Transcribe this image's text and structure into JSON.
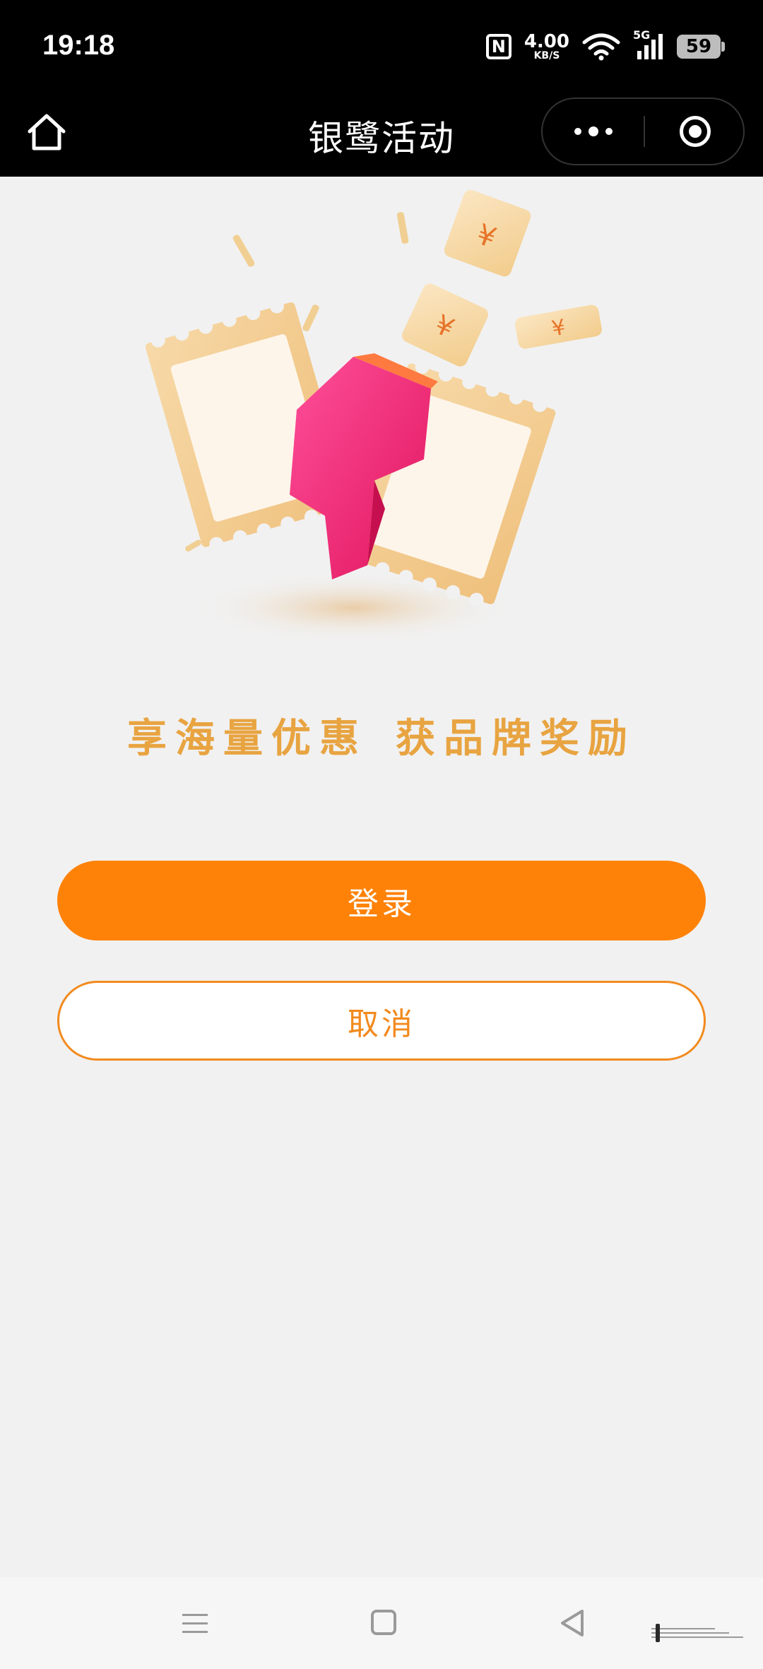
{
  "status_bar": {
    "time": "19:18",
    "nfc_label": "N",
    "net_speed": "4.00",
    "net_speed_unit": "KB/S",
    "signal_label": "5G",
    "battery": "59"
  },
  "header": {
    "title": "银鹭活动"
  },
  "main": {
    "slogan_left": "享海量优惠",
    "slogan_right": "获品牌奖励",
    "login_label": "登录",
    "cancel_label": "取消"
  },
  "colors": {
    "primary": "#fe8208",
    "slogan": "#e8a441",
    "background": "#f1f1f1"
  },
  "icons": {
    "header_home": "home-icon",
    "more": "more-dots-icon",
    "close": "target-icon",
    "nav_menu": "menu-icon",
    "nav_home": "square-icon",
    "nav_back": "back-triangle-icon"
  }
}
